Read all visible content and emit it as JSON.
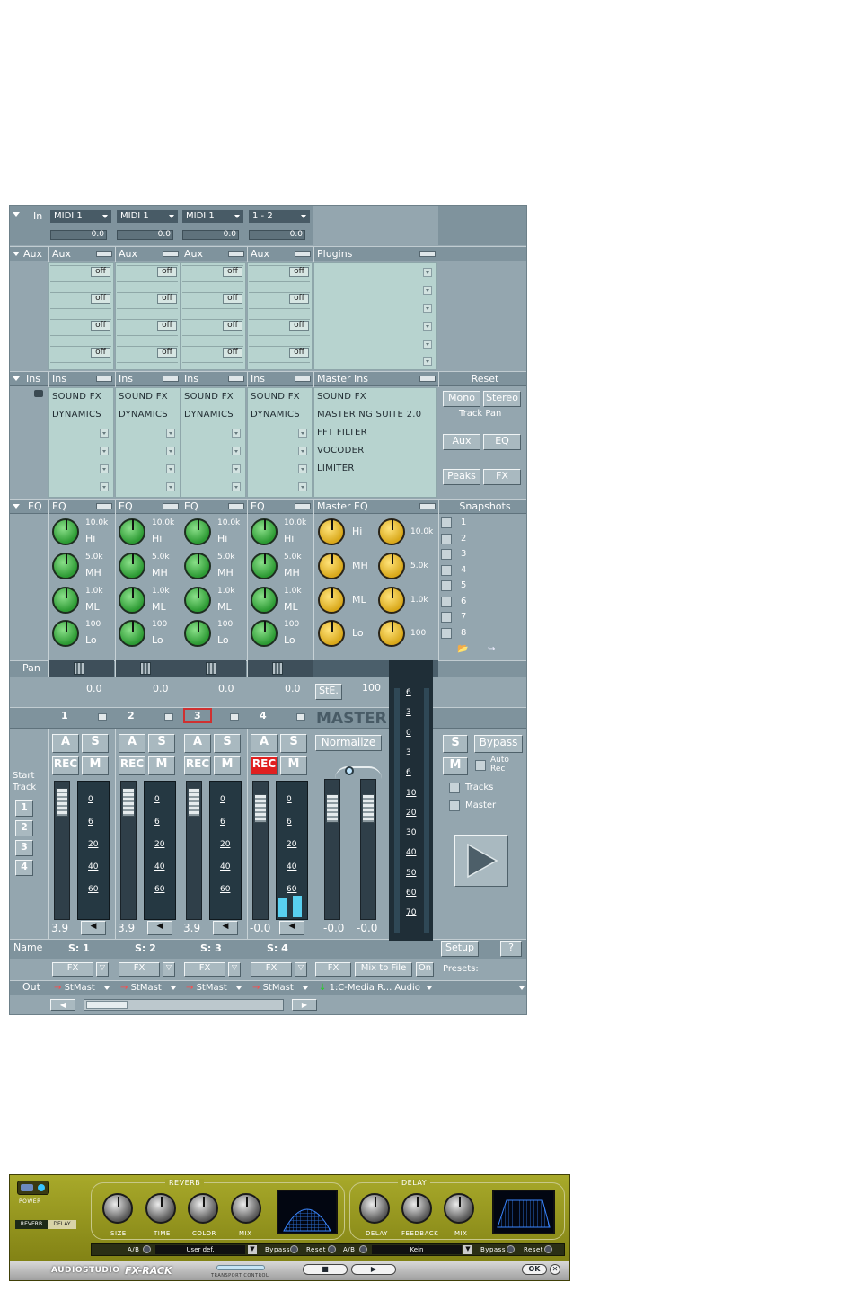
{
  "mixer": {
    "sections": {
      "in": "In",
      "aux": "Aux",
      "ins": "Ins",
      "eq": "EQ",
      "pan": "Pan",
      "name": "Name",
      "out": "Out",
      "start_track": "Start Track"
    },
    "in_channels": [
      {
        "source": "MIDI 1",
        "level": "0.0"
      },
      {
        "source": "MIDI 1",
        "level": "0.0"
      },
      {
        "source": "MIDI 1",
        "level": "0.0"
      },
      {
        "source": "1 - 2",
        "level": "0.0"
      }
    ],
    "aux_header": "Aux",
    "plugins_header": "Plugins",
    "aux_off": "off",
    "ins_header": "Ins",
    "master_ins_header": "Master Ins",
    "channel_inserts": [
      "SOUND FX",
      "DYNAMICS"
    ],
    "master_inserts": [
      "SOUND FX",
      "MASTERING SUITE 2.0",
      "FFT FILTER",
      "VOCODER",
      "LIMITER"
    ],
    "reset_header": "Reset",
    "right_buttons": {
      "mono": "Mono",
      "stereo": "Stereo",
      "track_pan": "Track Pan",
      "aux": "Aux",
      "eq": "EQ",
      "peaks": "Peaks",
      "fx": "FX"
    },
    "eq_header": "EQ",
    "master_eq_header": "Master EQ",
    "snapshots_header": "Snapshots",
    "snapshots": [
      "1",
      "2",
      "3",
      "4",
      "5",
      "6",
      "7",
      "8"
    ],
    "eq_bands": [
      {
        "freq": "10.0k",
        "name": "Hi"
      },
      {
        "freq": "5.0k",
        "name": "MH"
      },
      {
        "freq": "1.0k",
        "name": "ML"
      },
      {
        "freq": "100",
        "name": "Lo"
      }
    ],
    "pan_values": [
      "0.0",
      "0.0",
      "0.0",
      "0.0"
    ],
    "ste_label": "StE.",
    "master_width": "100",
    "track_numbers": [
      "1",
      "2",
      "3",
      "4"
    ],
    "master_label": "MASTER",
    "btn_a": "A",
    "btn_s": "S",
    "btn_rec": "REC",
    "btn_m": "M",
    "normalize": "Normalize",
    "bypass": "Bypass",
    "auto_rec": "Auto Rec",
    "tracks": "Tracks",
    "master_chk": "Master",
    "start_track_buttons": [
      "1",
      "2",
      "3",
      "4"
    ],
    "meter_scale": [
      "0",
      "6",
      "20",
      "40",
      "60"
    ],
    "master_scale": [
      "6",
      "3",
      "0",
      "3",
      "6",
      "10",
      "20",
      "30",
      "40",
      "50",
      "60",
      "70"
    ],
    "fader_values": [
      "3.9",
      "3.9",
      "3.9",
      "-0.0"
    ],
    "master_values": [
      "-0.0",
      "-0.0"
    ],
    "names": [
      "S: 1",
      "S: 2",
      "S: 3",
      "S: 4"
    ],
    "fx": "FX",
    "mix_to_file": "Mix to File",
    "on": "On",
    "setup": "Setup",
    "help": "?",
    "presets": "Presets:",
    "outs": [
      "StMast",
      "StMast",
      "StMast",
      "StMast"
    ],
    "master_out": "1:C-Media R... Audio"
  },
  "fxrack": {
    "power": "POWER",
    "reverb_tab": "REVERB",
    "delay_tab": "DELAY",
    "reverb_title": "REVERB",
    "delay_title": "DELAY",
    "reverb_knobs": [
      "SIZE",
      "TIME",
      "COLOR",
      "MIX"
    ],
    "delay_knobs": [
      "DELAY",
      "FEEDBACK",
      "MIX"
    ],
    "ab": "A/B",
    "reverb_preset": "User def.",
    "delay_preset": "Kein",
    "bypass": "Bypass",
    "reset": "Reset",
    "brand": "AUDIOSTUDIO",
    "product": "FX-RACK",
    "transport": "TRANSPORT CONTROL",
    "ok": "OK"
  },
  "colors": {
    "panel": "#94a6af",
    "rec_active": "#e02020",
    "knob_green": "#2c9a33",
    "knob_yellow": "#d9a81a",
    "rack_olive": "#8e8e18"
  }
}
